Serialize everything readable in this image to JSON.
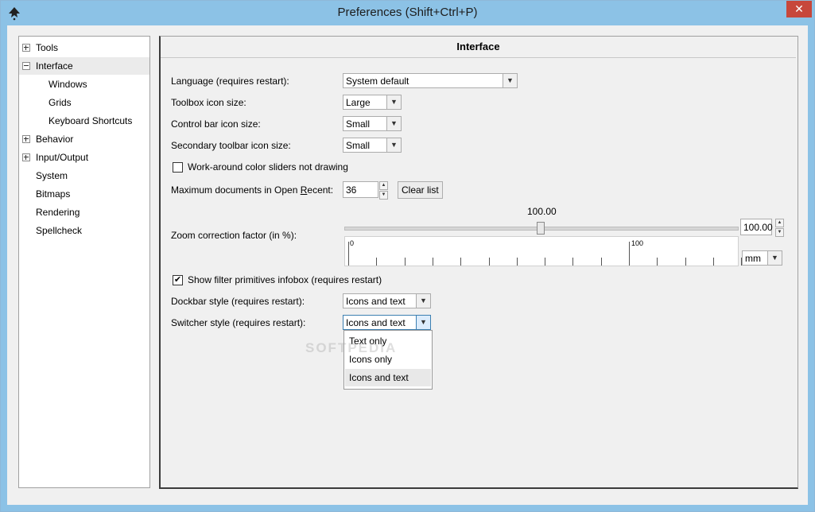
{
  "window": {
    "title": "Preferences (Shift+Ctrl+P)",
    "close": "✕"
  },
  "tree": {
    "items": [
      {
        "label": "Tools",
        "expander": "+",
        "selected": false
      },
      {
        "label": "Interface",
        "expander": "-",
        "selected": true
      },
      {
        "label": "Windows"
      },
      {
        "label": "Grids"
      },
      {
        "label": "Keyboard Shortcuts"
      },
      {
        "label": "Behavior",
        "expander": "+"
      },
      {
        "label": "Input/Output",
        "expander": "+"
      },
      {
        "label": "System"
      },
      {
        "label": "Bitmaps"
      },
      {
        "label": "Rendering"
      },
      {
        "label": "Spellcheck"
      }
    ]
  },
  "panel": {
    "title": "Interface",
    "language_label": "Language (requires restart):",
    "language_value": "System default",
    "toolbox_label": "Toolbox icon size:",
    "toolbox_value": "Large",
    "controlbar_label": "Control bar icon size:",
    "controlbar_value": "Small",
    "secondary_label": "Secondary toolbar icon size:",
    "secondary_value": "Small",
    "workaround_label": "Work-around color sliders not drawing",
    "workaround_checked": false,
    "maxdocs_label_pre": "Maximum documents in Open ",
    "maxdocs_label_u": "R",
    "maxdocs_label_post": "ecent:",
    "maxdocs_value": "36",
    "clear_list": "Clear list",
    "zoom_label": "Zoom correction factor (in %):",
    "zoom_slider_value": "100.00",
    "zoom_spin_value": "100.00",
    "zoom_fraction": 0.5,
    "ruler_label_0": "0",
    "ruler_label_100": "100",
    "unit_value": "mm",
    "filter_label": "Show filter primitives infobox (requires restart)",
    "filter_checked": true,
    "check_mark": "✔",
    "dockbar_label": "Dockbar style (requires restart):",
    "dockbar_value": "Icons and text",
    "switcher_label": "Switcher style (requires restart):",
    "switcher_value": "Icons and text",
    "switcher_options": [
      "Text only",
      "Icons only",
      "Icons and text"
    ]
  },
  "icons": {
    "dropdown_arrow": "▼",
    "spin_up": "▲",
    "spin_down": "▼"
  },
  "watermark": "SOFTPEDIA"
}
